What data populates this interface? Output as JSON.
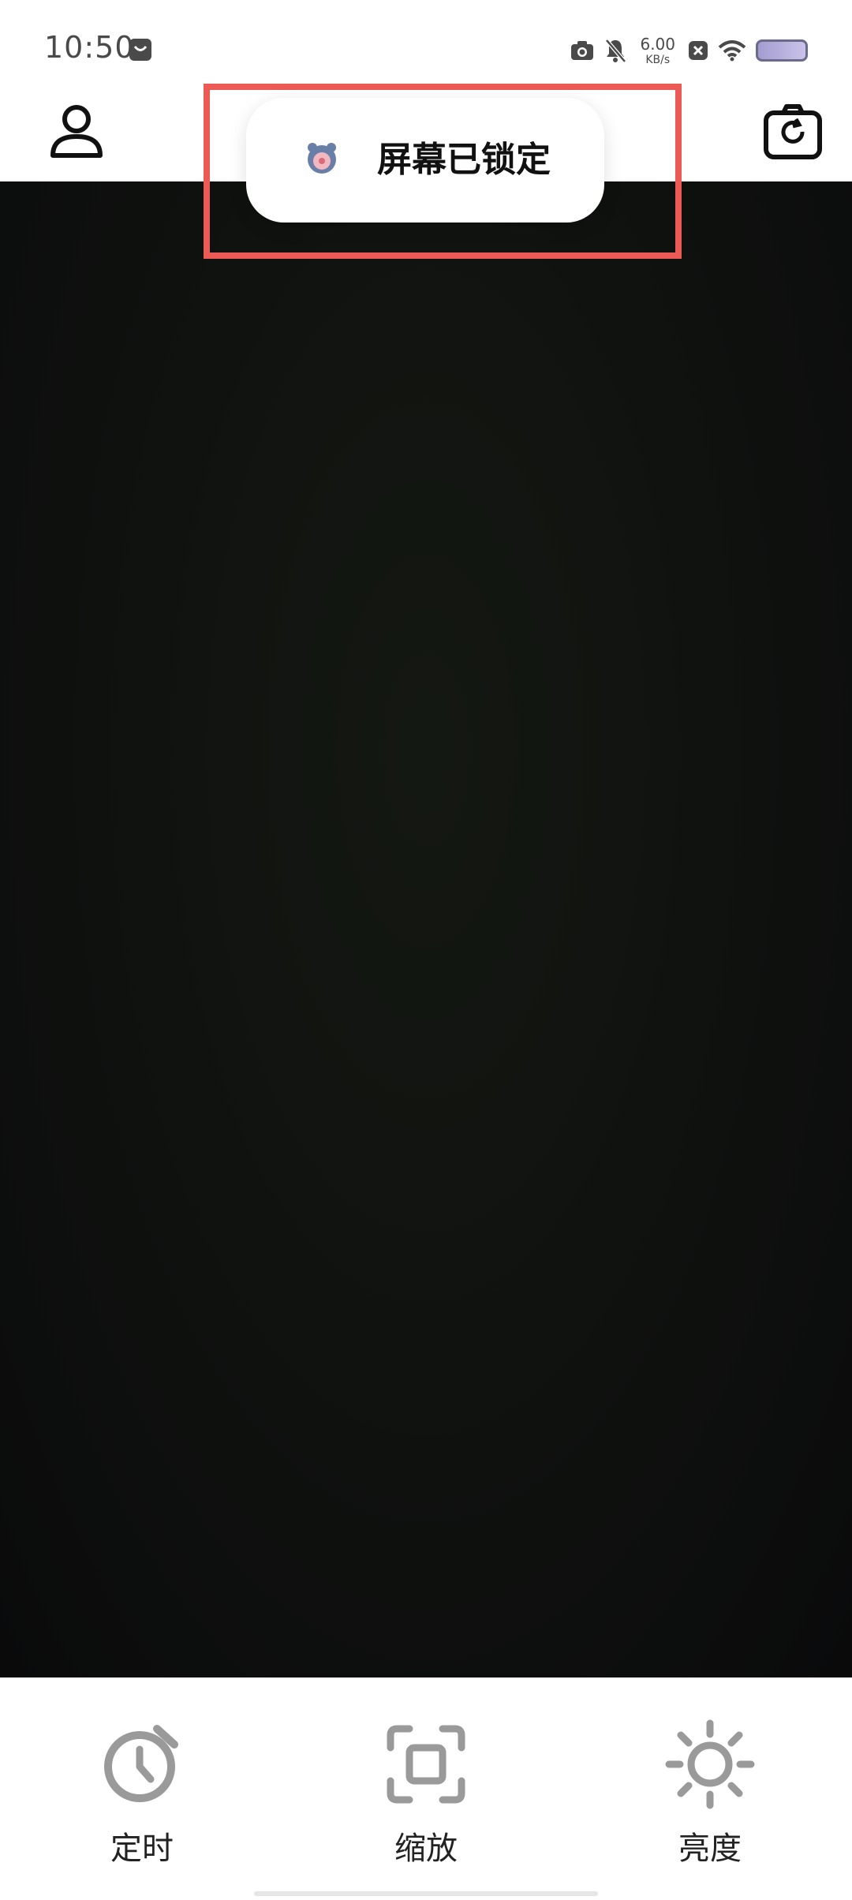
{
  "status_bar": {
    "time": "10:50",
    "net_speed_value": "6.00",
    "net_speed_unit": "KB/s",
    "icons": [
      "note-icon",
      "camera-icon",
      "mute-icon",
      "close-box-icon",
      "wifi-icon",
      "battery-icon"
    ],
    "battery_color": "#a49ccf"
  },
  "top_bar": {
    "icons": [
      "profile-icon",
      "switch-camera-icon"
    ]
  },
  "toast": {
    "text": "屏幕已锁定",
    "app_icon": "bear-app-icon",
    "highlight_color": "#ec5a55"
  },
  "controls": [
    {
      "label": "定时",
      "icon": "timer-icon"
    },
    {
      "label": "缩放",
      "icon": "zoom-frame-icon"
    },
    {
      "label": "亮度",
      "icon": "brightness-icon"
    }
  ]
}
